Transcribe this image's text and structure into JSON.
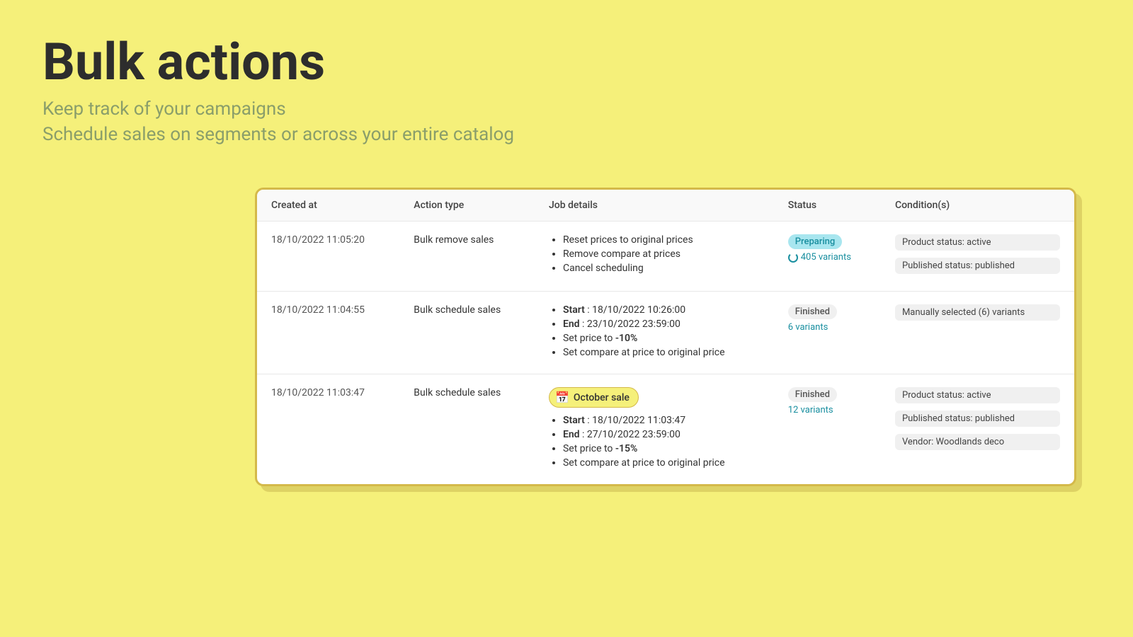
{
  "hero": {
    "title": "Bulk actions",
    "subtitle1": "Keep track of your campaigns",
    "subtitle2": "Schedule sales on segments or across your entire catalog"
  },
  "table": {
    "headers": [
      "Created at",
      "Action type",
      "Job details",
      "Status",
      "Condition(s)"
    ],
    "rows": [
      {
        "created_at": "18/10/2022 11:05:20",
        "action_type": "Bulk remove sales",
        "job_details": [
          "Reset prices to original prices",
          "Remove compare at prices",
          "Cancel scheduling"
        ],
        "campaign_name": null,
        "status_label": "Preparing",
        "status_type": "preparing",
        "variants_count": "405 variants",
        "conditions": [
          "Product status: active",
          "Published status: published"
        ]
      },
      {
        "created_at": "18/10/2022 11:04:55",
        "action_type": "Bulk schedule sales",
        "job_details_parts": [
          {
            "prefix": "Start",
            "value": " : 18/10/2022 10:26:00"
          },
          {
            "prefix": "End",
            "value": " : 23/10/2022 23:59:00"
          },
          {
            "prefix": "Set price to ",
            "value": "-10%",
            "bold_value": true
          },
          {
            "prefix": "Set compare at price to original price",
            "value": ""
          }
        ],
        "campaign_name": null,
        "status_label": "Finished",
        "status_type": "finished",
        "variants_count": "6 variants",
        "conditions": [
          "Manually selected (6) variants"
        ]
      },
      {
        "created_at": "18/10/2022 11:03:47",
        "action_type": "Bulk schedule sales",
        "campaign_name": "October sale",
        "job_details_parts": [
          {
            "prefix": "Start",
            "value": " : 18/10/2022 11:03:47"
          },
          {
            "prefix": "End",
            "value": " : 27/10/2022 23:59:00"
          },
          {
            "prefix": "Set price to ",
            "value": "-15%",
            "bold_value": true
          },
          {
            "prefix": "Set compare at price to original price",
            "value": ""
          }
        ],
        "status_label": "Finished",
        "status_type": "finished",
        "variants_count": "12 variants",
        "conditions": [
          "Product status: active",
          "Published status: published",
          "Vendor: Woodlands deco"
        ]
      }
    ]
  }
}
